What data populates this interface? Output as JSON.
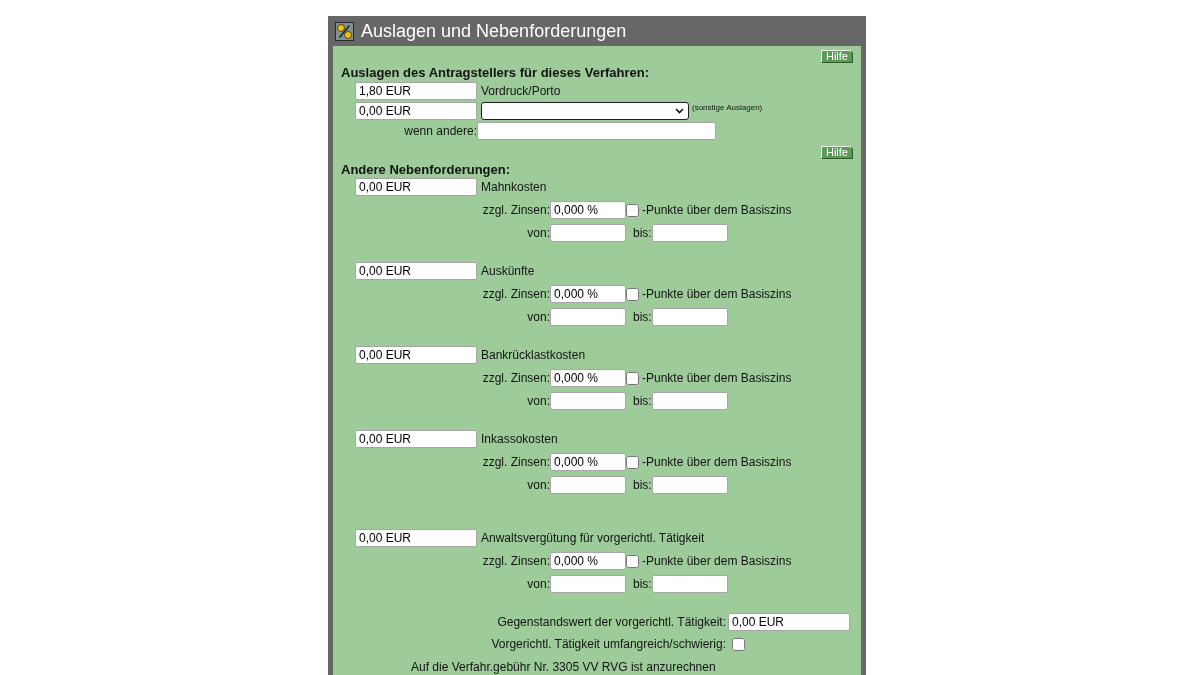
{
  "window": {
    "title": "Auslagen und Nebenforderungen"
  },
  "expenses": {
    "help_button": "Hilfe",
    "heading": "Auslagen des Antragstellers für dieses Verfahren:",
    "form_costs": {
      "value": "1,80 EUR",
      "label": "Vordruck/Porto"
    },
    "other_costs": {
      "value": "0,00 EUR",
      "note": "(sonstige Auslagen)"
    },
    "other_description": {
      "label": "wenn andere:"
    }
  },
  "claims": {
    "help_button": "Hilfe",
    "heading": "Andere Nebenforderungen:",
    "items": [
      {
        "amount": "0,00 EUR",
        "label": "Mahnkosten",
        "interest_label": "zzgl. Zinsen:",
        "interest": "0,000 %",
        "points_checked": false,
        "points_label": "-Punkte über dem Basiszins",
        "from_label": "von:",
        "to_label": "bis:"
      },
      {
        "amount": "0,00 EUR",
        "label": "Auskünfte",
        "interest_label": "zzgl. Zinsen:",
        "interest": "0,000 %",
        "points_checked": false,
        "points_label": "-Punkte über dem Basiszins",
        "from_label": "von:",
        "to_label": "bis:"
      },
      {
        "amount": "0,00 EUR",
        "label": "Bankrücklastkosten",
        "interest_label": "zzgl. Zinsen:",
        "interest": "0,000 %",
        "points_checked": false,
        "points_label": "-Punkte über dem Basiszins",
        "from_label": "von:",
        "to_label": "bis:"
      },
      {
        "amount": "0,00 EUR",
        "label": "Inkassokosten",
        "interest_label": "zzgl. Zinsen:",
        "interest": "0,000 %",
        "points_checked": false,
        "points_label": "-Punkte über dem Basiszins",
        "from_label": "von:",
        "to_label": "bis:"
      }
    ]
  },
  "pre_litigation": {
    "claim": {
      "amount": "0,00 EUR",
      "label": "Anwaltsvergütung für vorgerichtl. Tätigkeit",
      "interest_label": "zzgl. Zinsen:",
      "interest": "0,000 %",
      "points_checked": false,
      "points_label": "-Punkte über dem Basiszins",
      "from_label": "von:",
      "to_label": "bis:"
    },
    "value_label": "Gegenstandswert der vorgerichtl. Tätigkeit:",
    "value": "0,00 EUR",
    "complex_label": "Vorgerichtl. Tätigkeit umfangreich/schwierig:",
    "complex_checked": false,
    "note": "Auf die Verfahr.gebühr Nr. 3305 VV RVG ist anzurechnen"
  }
}
